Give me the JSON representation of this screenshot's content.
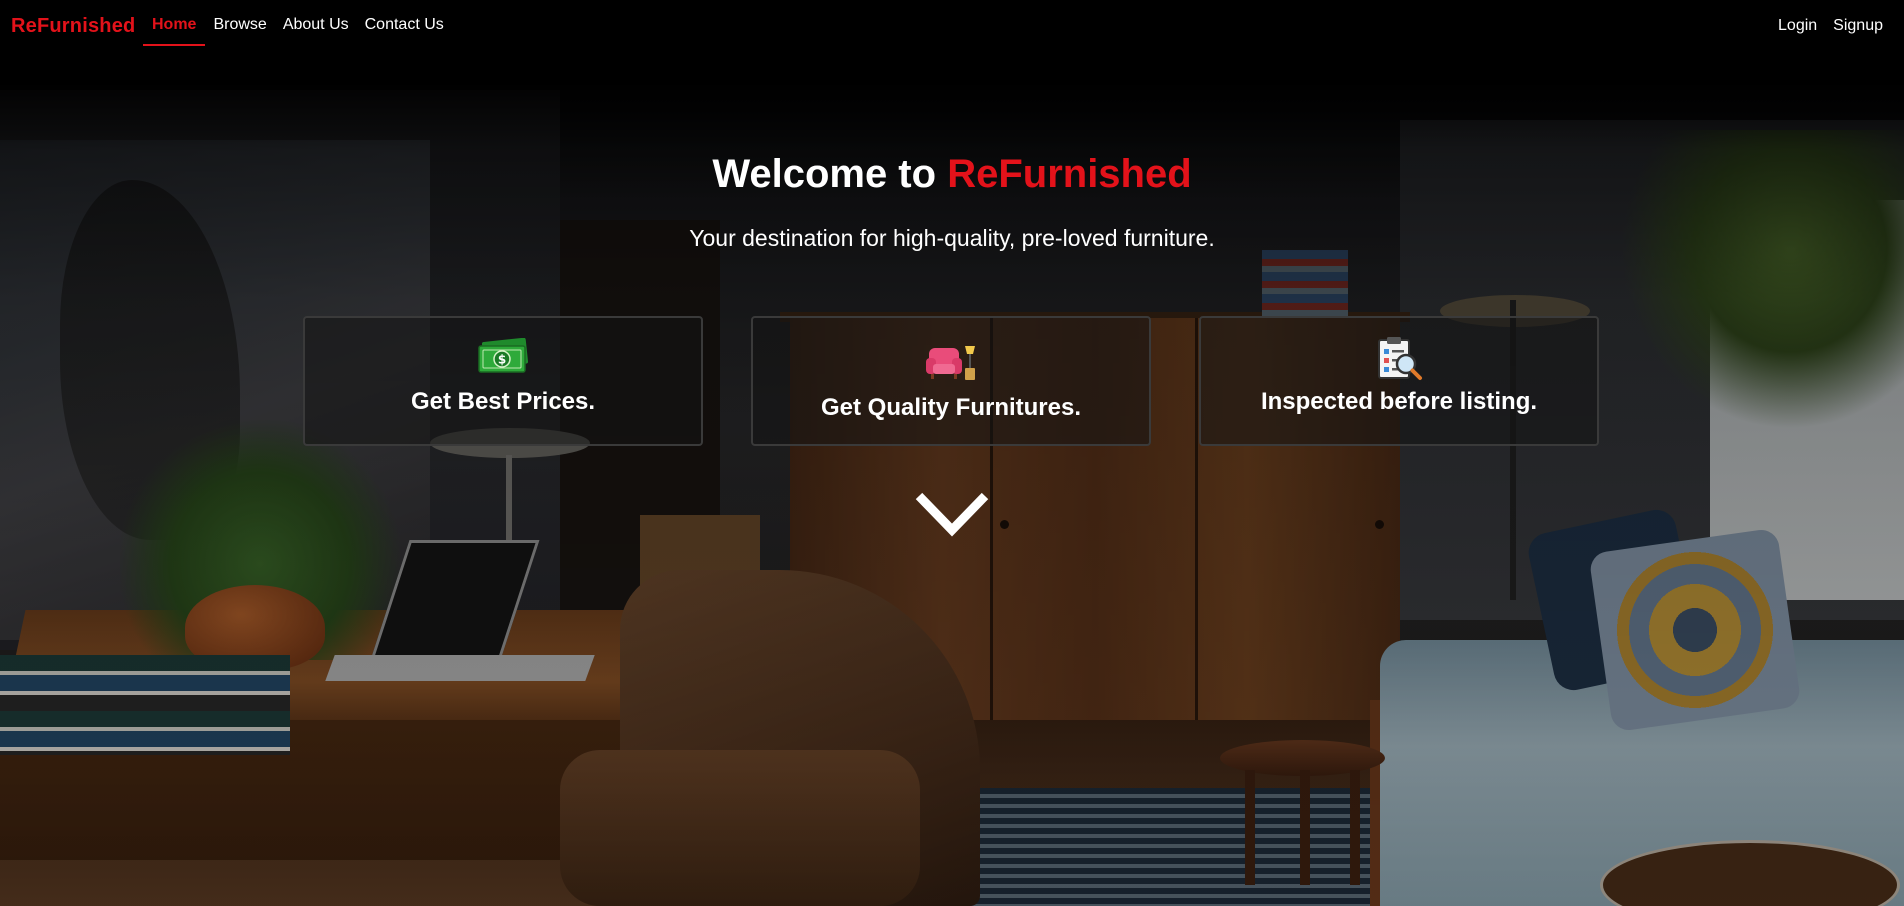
{
  "navbar": {
    "brand": "ReFurnished",
    "links": [
      {
        "label": "Home",
        "active": true
      },
      {
        "label": "Browse",
        "active": false
      },
      {
        "label": "About Us",
        "active": false
      },
      {
        "label": "Contact Us",
        "active": false
      }
    ],
    "auth": {
      "login": "Login",
      "signup": "Signup"
    }
  },
  "hero": {
    "title_prefix": "Welcome to ",
    "title_brand": "ReFurnished",
    "subtitle": "Your destination for high-quality, pre-loved furniture."
  },
  "features": [
    {
      "icon": "money-icon",
      "label": "Get Best Prices."
    },
    {
      "icon": "armchair-lamp-icon",
      "label": "Get Quality Furnitures."
    },
    {
      "icon": "inspection-clipboard-icon",
      "label": "Inspected before listing."
    }
  ],
  "scroll_indicator": {
    "icon": "chevron-down-icon"
  },
  "colors": {
    "accent": "#e3121a",
    "text": "#ffffff",
    "background": "#000000"
  }
}
